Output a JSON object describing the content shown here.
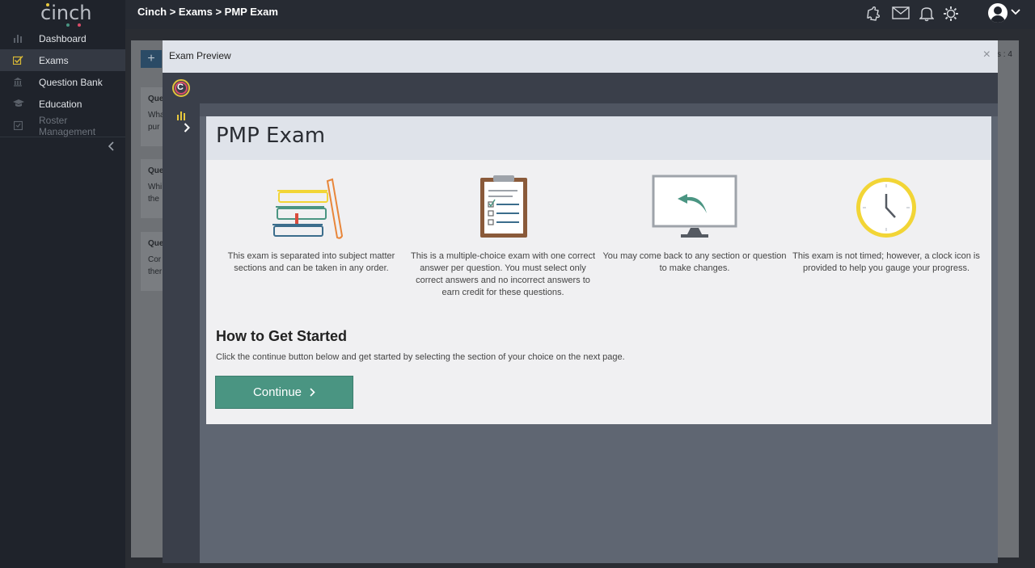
{
  "app": {
    "logo_text": "cinch",
    "breadcrumb": "Cinch > Exams > PMP Exam"
  },
  "sidebar": {
    "items": [
      {
        "label": "Dashboard",
        "icon": "bar-chart-icon"
      },
      {
        "label": "Exams",
        "icon": "checklist-icon"
      },
      {
        "label": "Question Bank",
        "icon": "bank-icon"
      },
      {
        "label": "Education",
        "icon": "graduation-cap-icon"
      },
      {
        "label": "Roster Management",
        "icon": "clipboard-icon"
      }
    ],
    "active": "Exams"
  },
  "background": {
    "card_labels": [
      "Que",
      "Que",
      "Que"
    ],
    "card_lines": [
      [
        "Wha",
        "pur"
      ],
      [
        "Whi",
        "the"
      ],
      [
        "Cor",
        "ther"
      ]
    ],
    "right_text": "s : 4"
  },
  "modal": {
    "title": "Exam Preview",
    "close": "×"
  },
  "exam": {
    "title": "PMP Exam",
    "features": [
      {
        "icon": "books-icon",
        "text": "This exam is separated into subject matter sections and can be taken in any order."
      },
      {
        "icon": "clipboard-checklist-icon",
        "text": "This is a multiple-choice exam with one correct answer per question. You must select only correct answers and no incorrect answers to earn credit for these questions."
      },
      {
        "icon": "monitor-back-arrow-icon",
        "text": "You may come back to any section or question to make changes."
      },
      {
        "icon": "clock-icon",
        "text": "This exam is not timed; however, a clock icon is provided to help you gauge your progress."
      }
    ],
    "howto_title": "How to Get Started",
    "howto_text": "Click the continue button below and get started by selecting the section of your choice on the next page.",
    "continue_label": "Continue"
  },
  "colors": {
    "accent": "#4a9582",
    "sidebar": "#1f232b",
    "clock_yellow": "#f2d536"
  }
}
